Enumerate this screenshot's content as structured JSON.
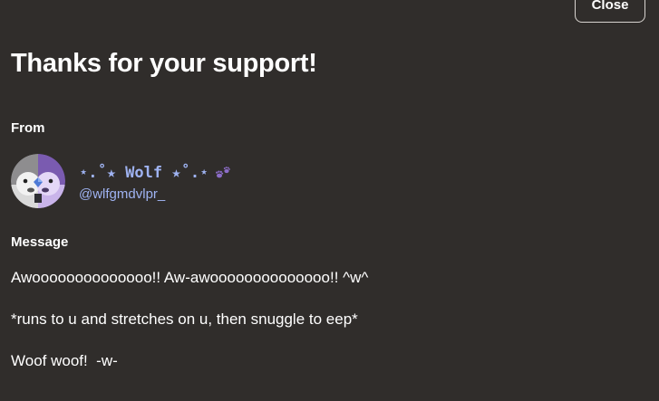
{
  "dialog": {
    "close_label": "Close",
    "title": "Thanks for your support!"
  },
  "from": {
    "label": "From",
    "display_name": "⋆.˚★ Wolf ★˚.⋆",
    "handle": "@wlfgmdvlpr_",
    "avatar_icon": "wolf-avatar-icon",
    "paw_icon": "paw-prints-icon"
  },
  "message": {
    "label": "Message",
    "lines": [
      "Awoooooooooooooo!! Aw-awoooooooooooooo!! ^w^",
      "*runs to u and stretches on u, then snuggle to eep*",
      "Woof woof!  -w-"
    ]
  },
  "colors": {
    "background": "#302d2b",
    "link_accent": "#9fb3f2",
    "text": "#ffffff"
  }
}
